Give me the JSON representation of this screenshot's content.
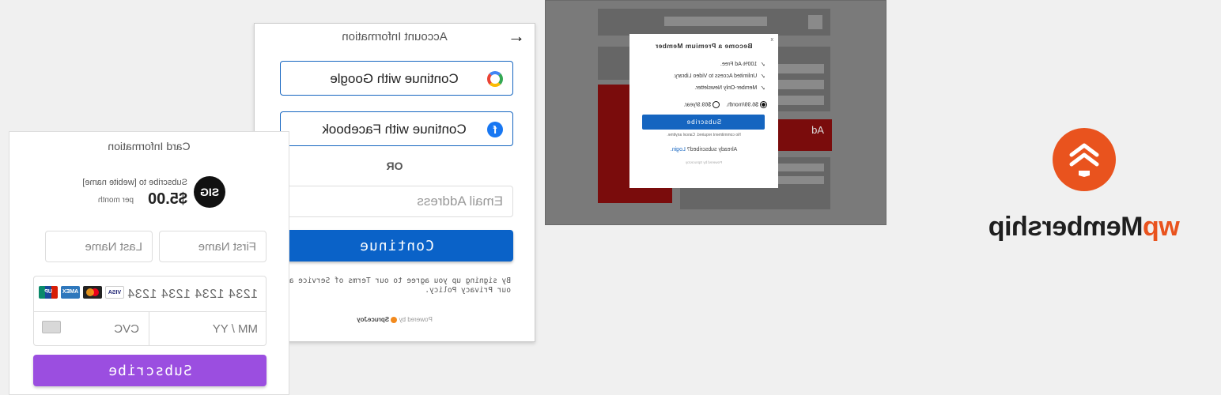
{
  "logo": {
    "prefix": "wp",
    "name": "Membership"
  },
  "premium_modal": {
    "close": "x",
    "title": "Become a Premium Member",
    "benefits": [
      "100% Ad Free.",
      "Unlimited Access to Video Library.",
      "Member-Only Newsletter."
    ],
    "plans": [
      "$6.99/month.",
      "$69.9/year."
    ],
    "selected_plan_index": 0,
    "subscribe_label": "Subscribe",
    "note": "No commitment required. Cancel anytime.",
    "login_prompt": "Already subscribed?",
    "login_link": "Login.",
    "powered": "Powered by SpruceJoy",
    "ad_label": "Ad"
  },
  "account": {
    "title": "Account Information",
    "back_icon": "arrow-left-icon",
    "google_label": "Continue with Google",
    "facebook_label": "Continue with Facebook",
    "or_label": "OR",
    "email_placeholder": "Email Address",
    "continue_label": "Continue",
    "terms": "By signing up you agree to our Terms of Service and our Privacy Policy.",
    "powered_prefix": "Powered by",
    "powered_brand": "SpruceJoy"
  },
  "card": {
    "title": "Card Information",
    "seller_logo_text": "SIG",
    "subscribe_to": "Subscribe to [webite name]",
    "price": "$5.00",
    "period": "per month",
    "first_name_placeholder": "First Name",
    "last_name_placeholder": "Last Name",
    "card_number": "1234 1234 1234 1234",
    "brands": [
      "VISA",
      "",
      "AMEX",
      "UP"
    ],
    "expiry_placeholder": "MM / YY",
    "cvc_placeholder": "CVC",
    "subscribe_label": "Subscribe"
  },
  "colors": {
    "brand_orange": "#e9531e",
    "continue_blue": "#0a62c8",
    "subscribe_purple": "#9b4ee0"
  }
}
